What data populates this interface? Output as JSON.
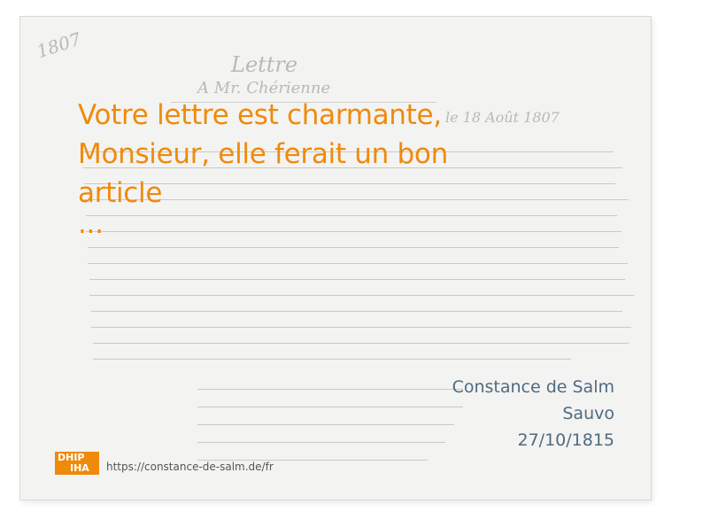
{
  "document": {
    "year_mark": "1807",
    "heading_title": "Lettre",
    "heading_recipient": "A Mr. Chérienne",
    "date_line": "le 18 Août 1807"
  },
  "quote": {
    "line1": " Votre lettre est charmante,",
    "line2": "Monsieur, elle ferait un bon article",
    "line3": "..."
  },
  "meta": {
    "author": "Constance de Salm",
    "place": "Sauvo",
    "date": "27/10/1815"
  },
  "footer": {
    "logo_top": "DHIP",
    "logo_bottom": "IHA",
    "url": "https://constance-de-salm.de/fr"
  },
  "colors": {
    "accent": "#f08a0a",
    "meta_text": "#4f6b7f"
  }
}
